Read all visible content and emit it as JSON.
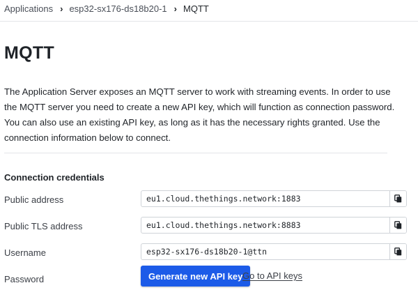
{
  "breadcrumb": {
    "items": [
      "Applications",
      "esp32-sx176-ds18b20-1",
      "MQTT"
    ]
  },
  "page": {
    "title": "MQTT",
    "description": "The Application Server exposes an MQTT server to work with streaming events. In order to use the MQTT server you need to create a new API key, which will function as connection password. You can also use an existing API key, as long as it has the necessary rights granted. Use the connection information below to connect."
  },
  "credentials": {
    "section_title": "Connection credentials",
    "public_address": {
      "label": "Public address",
      "value": "eu1.cloud.thethings.network:1883"
    },
    "public_tls_address": {
      "label": "Public TLS address",
      "value": "eu1.cloud.thethings.network:8883"
    },
    "username": {
      "label": "Username",
      "value": "esp32-sx176-ds18b20-1@ttn"
    },
    "password": {
      "label": "Password",
      "generate_label": "Generate new API key",
      "goto_label": "Go to API keys"
    }
  },
  "icons": {
    "breadcrumb_separator": "chevron-right-icon",
    "copy": "copy-icon"
  },
  "colors": {
    "primary": "#1c5be8",
    "text": "#1f2328",
    "muted": "#3c4047",
    "border": "#cfd3d8"
  }
}
